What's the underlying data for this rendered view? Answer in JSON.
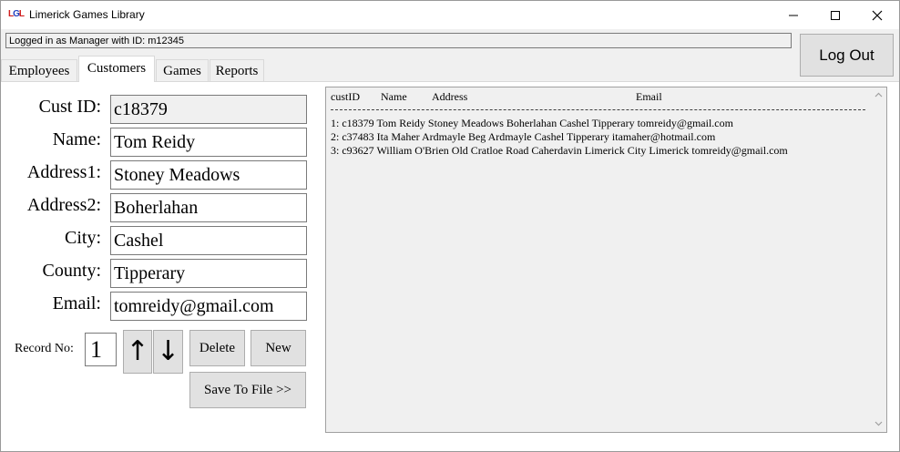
{
  "window": {
    "title": "Limerick Games Library",
    "icon_letters": {
      "l1": "L",
      "g": "G",
      "l2": "L"
    },
    "minimize_icon": "minimize-icon",
    "maximize_icon": "maximize-icon",
    "close_icon": "close-icon"
  },
  "status": {
    "text": "Logged in as Manager with ID: m12345"
  },
  "logout": {
    "label": "Log Out"
  },
  "tabs": [
    {
      "label": "Employees"
    },
    {
      "label": "Customers"
    },
    {
      "label": "Games"
    },
    {
      "label": "Reports"
    }
  ],
  "form": {
    "fields": [
      {
        "label": "Cust ID:",
        "value": "c18379"
      },
      {
        "label": "Name:",
        "value": "Tom Reidy"
      },
      {
        "label": "Address1:",
        "value": "Stoney Meadows"
      },
      {
        "label": "Address2:",
        "value": "Boherlahan"
      },
      {
        "label": "City:",
        "value": "Cashel"
      },
      {
        "label": "County:",
        "value": "Tipperary"
      },
      {
        "label": "Email:",
        "value": "tomreidy@gmail.com"
      }
    ],
    "record_label": "Record No:",
    "record_value": "1",
    "up_arrow": "↑",
    "down_arrow": "↓",
    "delete_label": "Delete",
    "new_label": "New",
    "save_label": "Save To File >>"
  },
  "list": {
    "headers": {
      "custid": "custID",
      "name": "Name",
      "address": "Address",
      "email": "Email"
    },
    "rows": [
      "1:  c18379  Tom Reidy  Stoney Meadows  Boherlahan  Cashel  Tipperary  tomreidy@gmail.com",
      "2:  c37483  Ita Maher  Ardmayle Beg  Ardmayle  Cashel  Tipperary  itamaher@hotmail.com",
      "3:  c93627  William O'Brien  Old Cratloe Road  Caherdavin  Limerick City  Limerick  tomreidy@gmail.com"
    ]
  }
}
